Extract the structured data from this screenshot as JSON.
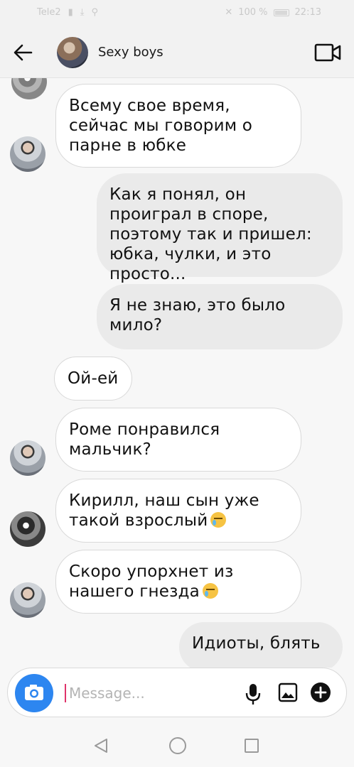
{
  "status_bar": {
    "carrier": "Tele2",
    "battery": "100 %",
    "time": "22:13"
  },
  "header": {
    "title": "Sexy boys"
  },
  "messages": [
    {
      "side": "in",
      "text": "Всему свое время, сейчас мы говорим о парне в юбке",
      "emoji": ""
    },
    {
      "side": "out",
      "text": "Как я понял, он проиграл в споре, поэтому так и пришел: юбка, чулки, и это просто...",
      "emoji": ""
    },
    {
      "side": "out",
      "text": "Я не знаю, это было мило?",
      "emoji": ""
    },
    {
      "side": "in",
      "text": "Ой-ей",
      "emoji": ""
    },
    {
      "side": "in",
      "text": "Роме понравился мальчик?",
      "emoji": ""
    },
    {
      "side": "in",
      "text": "Кирилл, наш сын уже такой взрослый",
      "emoji": "crying-face"
    },
    {
      "side": "in",
      "text": "Скоро упорхнет из нашего гнезда",
      "emoji": "crying-face"
    },
    {
      "side": "out",
      "text": "Идиоты, блять",
      "emoji": ""
    }
  ],
  "composer": {
    "placeholder": "Message...",
    "value": ""
  },
  "colors": {
    "accent": "#2d86f0",
    "cursor": "#e0346a",
    "incoming_bg": "#ffffff",
    "outgoing_bg": "#eaeaea"
  }
}
